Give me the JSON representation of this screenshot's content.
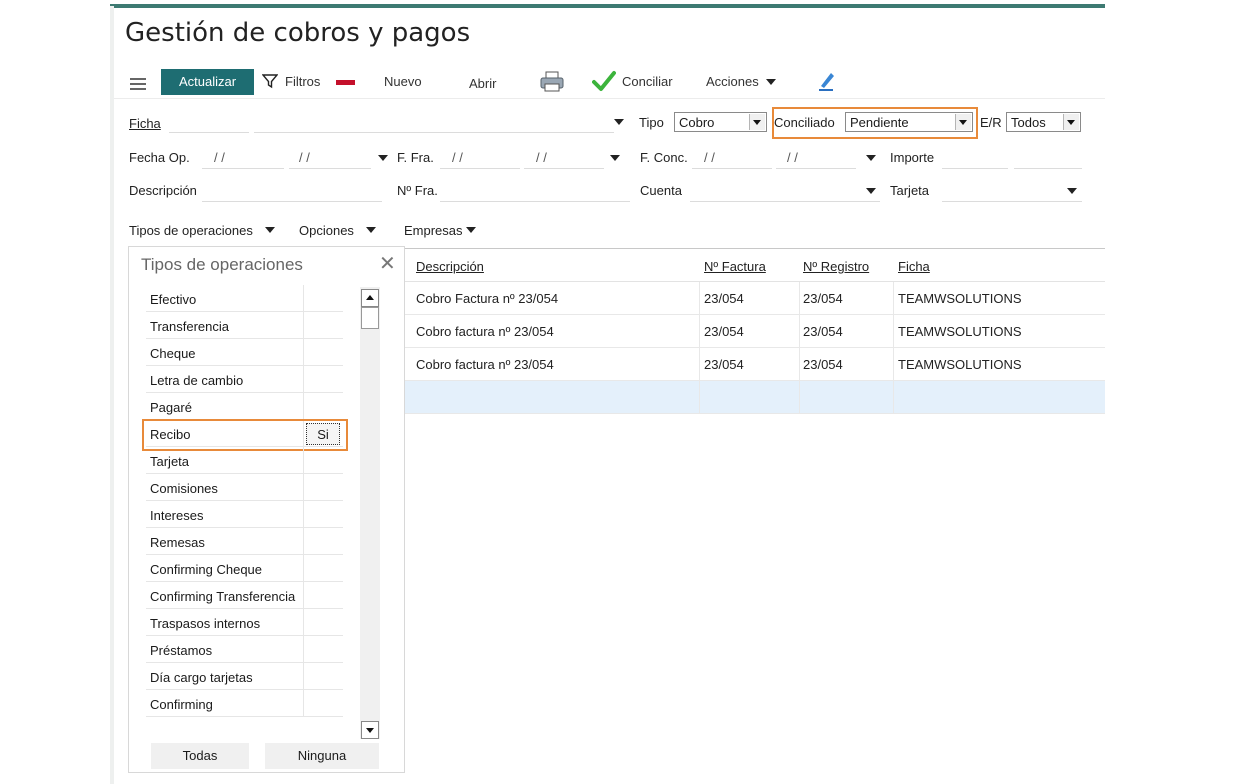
{
  "window": {
    "title": "Gestión de cobros y pagos"
  },
  "toolbar": {
    "actualizar": "Actualizar",
    "filtros": "Filtros",
    "nuevo": "Nuevo",
    "abrir": "Abrir",
    "conciliar": "Conciliar",
    "acciones": "Acciones"
  },
  "filters": {
    "ficha": "Ficha",
    "tipo_label": "Tipo",
    "tipo_value": "Cobro",
    "conciliado_label": "Conciliado",
    "conciliado_value": "Pendiente",
    "er_label": "E/R",
    "er_value": "Todos",
    "fecha_op": "Fecha Op.",
    "f_fra": "F. Fra.",
    "f_conc": "F. Conc.",
    "importe": "Importe",
    "descripcion": "Descripción",
    "n_fra": "Nº Fra.",
    "cuenta": "Cuenta",
    "tarjeta": "Tarjeta",
    "date_placeholder": "/ /"
  },
  "menus": {
    "tipos": "Tipos de operaciones",
    "opciones": "Opciones",
    "empresas": "Empresas"
  },
  "panel": {
    "title": "Tipos de operaciones",
    "items": [
      {
        "label": "Efectivo",
        "value": ""
      },
      {
        "label": "Transferencia",
        "value": ""
      },
      {
        "label": "Cheque",
        "value": ""
      },
      {
        "label": "Letra de cambio",
        "value": ""
      },
      {
        "label": "Pagaré",
        "value": ""
      },
      {
        "label": "Recibo",
        "value": "Si"
      },
      {
        "label": "Tarjeta",
        "value": ""
      },
      {
        "label": "Comisiones",
        "value": ""
      },
      {
        "label": "Intereses",
        "value": ""
      },
      {
        "label": "Remesas",
        "value": ""
      },
      {
        "label": "Confirming Cheque",
        "value": ""
      },
      {
        "label": "Confirming Transferencia",
        "value": ""
      },
      {
        "label": "Traspasos internos",
        "value": ""
      },
      {
        "label": "Préstamos",
        "value": ""
      },
      {
        "label": "Día cargo tarjetas",
        "value": ""
      },
      {
        "label": "Confirming",
        "value": ""
      }
    ],
    "todas": "Todas",
    "ninguna": "Ninguna"
  },
  "grid": {
    "columns": [
      "Descripción",
      "Nº Factura",
      "Nº Registro",
      "Ficha"
    ],
    "rows": [
      [
        "Cobro Factura nº 23/054",
        "23/054",
        "23/054",
        "TEAMWSOLUTIONS"
      ],
      [
        "Cobro factura nº 23/054",
        "23/054",
        "23/054",
        "TEAMWSOLUTIONS"
      ],
      [
        "Cobro factura nº 23/054",
        "23/054",
        "23/054",
        "TEAMWSOLUTIONS"
      ]
    ]
  },
  "colors": {
    "accent": "#1e6d72",
    "highlight": "#e88a3a",
    "selected_row": "#e4f0fb",
    "nuevo_mark": "#c4102b",
    "conciliar_check": "#3cb43c"
  },
  "icons": [
    "hamburger-icon",
    "filter-icon",
    "printer-icon",
    "check-icon",
    "pencil-icon",
    "close-icon"
  ]
}
